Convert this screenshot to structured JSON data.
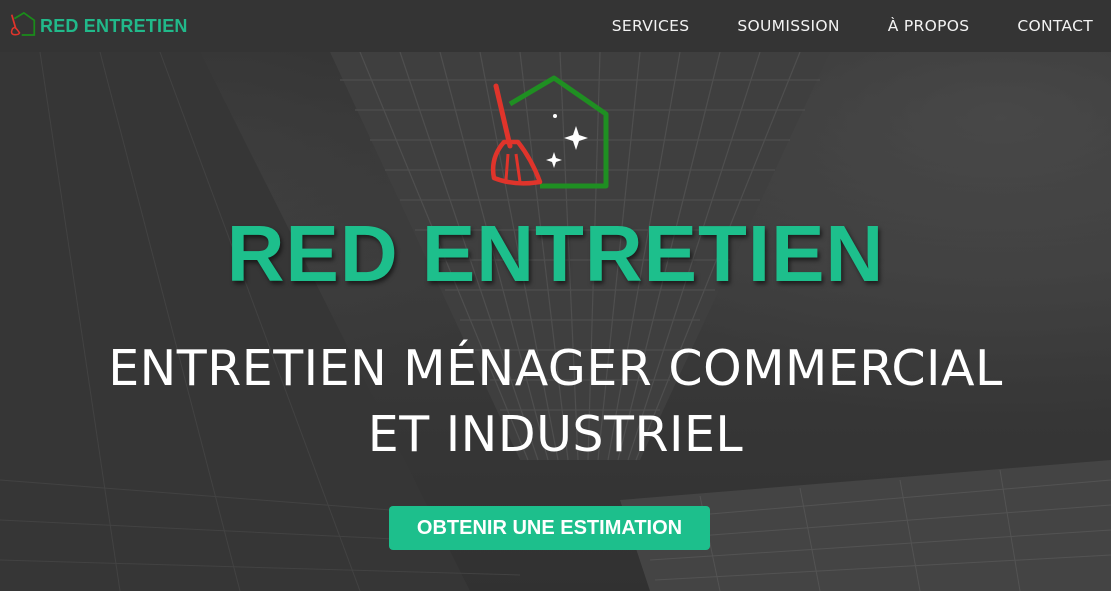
{
  "nav": {
    "brand": "RED ENTRETIEN",
    "links": [
      "SERVICES",
      "SOUMISSION",
      "À PROPOS",
      "CONTACT"
    ]
  },
  "hero": {
    "title": "RED ENTRETIEN",
    "subtitle_line1": "ENTRETIEN MÉNAGER COMMERCIAL",
    "subtitle_line2": "ET INDUSTRIEL",
    "cta_label": "OBTENIR UNE ESTIMATION"
  },
  "icons": {
    "logo": "house-broom-logo-icon"
  },
  "colors": {
    "accent": "#1dbf8c",
    "navbar": "#343434",
    "logo_house": "#1a8c1a",
    "logo_broom": "#e0342b"
  }
}
